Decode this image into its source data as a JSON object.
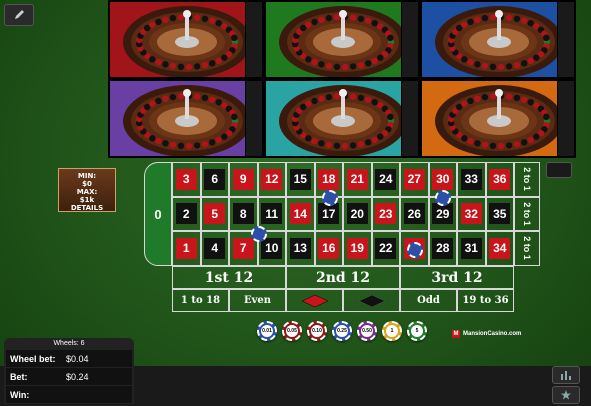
{
  "limits": {
    "min_label": "MIN:",
    "min_value": "$0",
    "max_label": "MAX:",
    "max_value": "$1k",
    "details": "DETAILS"
  },
  "wheel_colors": [
    "#a0141a",
    "#1f7a1f",
    "#1d4fa3",
    "#6a3fa3",
    "#2aa3a3",
    "#d36a12"
  ],
  "table": {
    "zero": "0",
    "rows": [
      [
        {
          "n": "3",
          "c": "red"
        },
        {
          "n": "6",
          "c": "black"
        },
        {
          "n": "9",
          "c": "red"
        },
        {
          "n": "12",
          "c": "red"
        },
        {
          "n": "15",
          "c": "black"
        },
        {
          "n": "18",
          "c": "red"
        },
        {
          "n": "21",
          "c": "red"
        },
        {
          "n": "24",
          "c": "black"
        },
        {
          "n": "27",
          "c": "red"
        },
        {
          "n": "30",
          "c": "red"
        },
        {
          "n": "33",
          "c": "black"
        },
        {
          "n": "36",
          "c": "red"
        }
      ],
      [
        {
          "n": "2",
          "c": "black"
        },
        {
          "n": "5",
          "c": "red"
        },
        {
          "n": "8",
          "c": "black"
        },
        {
          "n": "11",
          "c": "black"
        },
        {
          "n": "14",
          "c": "red"
        },
        {
          "n": "17",
          "c": "black"
        },
        {
          "n": "20",
          "c": "black"
        },
        {
          "n": "23",
          "c": "red"
        },
        {
          "n": "26",
          "c": "black"
        },
        {
          "n": "29",
          "c": "black"
        },
        {
          "n": "32",
          "c": "red"
        },
        {
          "n": "35",
          "c": "black"
        }
      ],
      [
        {
          "n": "1",
          "c": "red"
        },
        {
          "n": "4",
          "c": "black"
        },
        {
          "n": "7",
          "c": "red"
        },
        {
          "n": "10",
          "c": "black"
        },
        {
          "n": "13",
          "c": "black"
        },
        {
          "n": "16",
          "c": "red"
        },
        {
          "n": "19",
          "c": "red"
        },
        {
          "n": "22",
          "c": "black"
        },
        {
          "n": "25",
          "c": "red"
        },
        {
          "n": "28",
          "c": "black"
        },
        {
          "n": "31",
          "c": "black"
        },
        {
          "n": "34",
          "c": "red"
        }
      ]
    ],
    "column_bets": [
      "2 to 1",
      "2 to 1",
      "2 to 1"
    ],
    "dozens": [
      "1st 12",
      "2nd 12",
      "3rd 12"
    ],
    "outside": [
      "1 to 18",
      "Even",
      "",
      "",
      "Odd",
      "19 to 36"
    ]
  },
  "chips": [
    {
      "label": "0.01",
      "color": "#2c4fa8"
    },
    {
      "label": "0.05",
      "color": "#8c1a1a"
    },
    {
      "label": "0.10",
      "color": "#8c1a1a"
    },
    {
      "label": "0.25",
      "color": "#2c4fa8"
    },
    {
      "label": "0.50",
      "color": "#7a2a8c"
    },
    {
      "label": "1",
      "color": "#d9a41a"
    },
    {
      "label": "5",
      "color": "#1f7a2a"
    }
  ],
  "brand": {
    "mark": "M",
    "name": "MansionCasino.com"
  },
  "info": {
    "wheels": "Wheels: 6",
    "wheel_bet_label": "Wheel bet:",
    "wheel_bet_value": "$0.04",
    "bet_label": "Bet:",
    "bet_value": "$0.24",
    "win_label": "Win:",
    "win_value": ""
  },
  "icons": [
    "pencil-icon",
    "bars-icon",
    "star-icon"
  ]
}
